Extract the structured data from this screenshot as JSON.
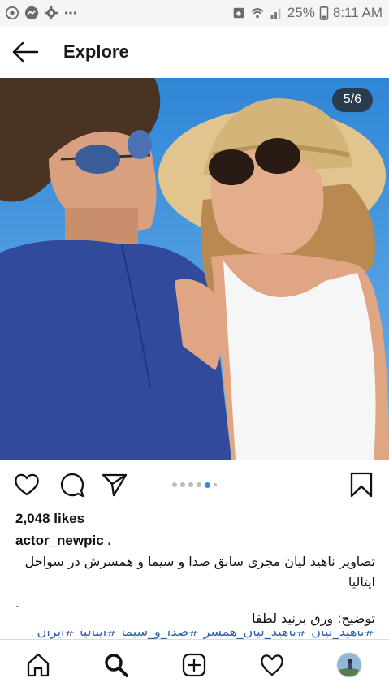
{
  "status_bar": {
    "battery": "25%",
    "time": "8:11 AM",
    "left_icons": [
      "whatsapp-icon",
      "messenger-icon",
      "settings-icon",
      "more-dots-icon"
    ],
    "right_icons": [
      "photo-icon",
      "wifi-icon",
      "signal-icon",
      "battery-icon"
    ]
  },
  "header": {
    "title": "Explore",
    "back_icon": "arrow-left-icon"
  },
  "post": {
    "image_counter": "5/6",
    "carousel": {
      "count": 6,
      "active_index": 4
    },
    "likes": "2,048 likes",
    "username": "actor_newpic .",
    "caption": "تصاویر ناهید لیان مجری سابق صدا و سیما و همسرش در سواحل ایتالیا",
    "dot_line": ".",
    "description": "توضیح: ورق بزنید لطفا",
    "hashtags": "#ناهید_لیان #ناهید_لیان_همسر #صدا_و_سیما #ایتالیا #ایران"
  },
  "actions": [
    "heart-icon",
    "comment-icon",
    "share-icon",
    "bookmark-icon"
  ],
  "tabbar": [
    "home-icon",
    "search-icon",
    "add-post-icon",
    "activity-heart-icon",
    "profile-avatar"
  ],
  "colors": {
    "accent": "#2f8fe8",
    "hashtag": "#2f5fa8",
    "sky": "#3f8fd8"
  }
}
